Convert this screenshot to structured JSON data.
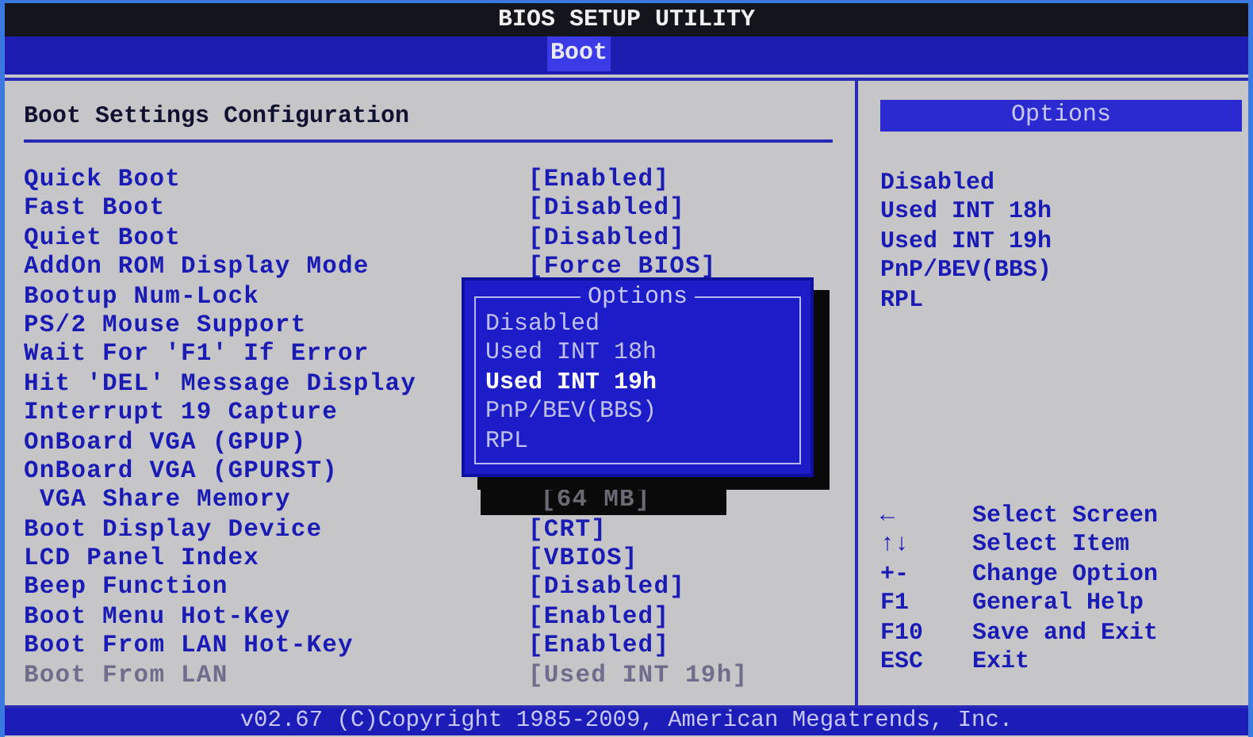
{
  "window": {
    "title": "BIOS SETUP UTILITY"
  },
  "tabs": [
    {
      "label": "Boot",
      "selected": true
    }
  ],
  "settings": {
    "heading": "Boot Settings Configuration",
    "rows": [
      {
        "label": "Quick Boot",
        "value": "[Enabled]",
        "disabled": false
      },
      {
        "label": "Fast Boot",
        "value": "[Disabled]",
        "disabled": false
      },
      {
        "label": "Quiet Boot",
        "value": "[Disabled]",
        "disabled": false
      },
      {
        "label": "AddOn ROM Display Mode",
        "value": "[Force BIOS]",
        "disabled": false
      },
      {
        "label": "Bootup Num-Lock",
        "disabled": false
      },
      {
        "label": "PS/2 Mouse Support",
        "disabled": false
      },
      {
        "label": "Wait For 'F1' If Error",
        "disabled": false
      },
      {
        "label": "Hit 'DEL' Message Display",
        "disabled": false
      },
      {
        "label": "Interrupt 19 Capture",
        "disabled": false
      },
      {
        "label": "OnBoard VGA (GPUP)",
        "disabled": false
      },
      {
        "label": "OnBoard VGA (GPURST)",
        "disabled": false,
        "children": [
          {
            "label": "VGA Share Memory",
            "value": "[64 MB]",
            "disabled": false,
            "shadowed": true
          }
        ]
      },
      {
        "label": "Boot Display Device",
        "value": "[CRT]",
        "disabled": false
      },
      {
        "label": "LCD Panel Index",
        "value": "[VBIOS]",
        "disabled": false
      },
      {
        "label": "Beep Function",
        "value": "[Disabled]",
        "disabled": false
      },
      {
        "label": "Boot Menu Hot-Key",
        "value": "[Enabled]",
        "disabled": false
      },
      {
        "label": "Boot From LAN Hot-Key",
        "value": "[Enabled]",
        "disabled": false
      },
      {
        "label": "Boot From LAN",
        "value": "[Used INT 19h]",
        "disabled": true
      }
    ]
  },
  "popup": {
    "title": "Options",
    "items": [
      {
        "label": "Disabled",
        "selected": false
      },
      {
        "label": "Used INT 18h",
        "selected": false
      },
      {
        "label": "Used INT 19h",
        "selected": true
      },
      {
        "label": "PnP/BEV(BBS)",
        "selected": false
      },
      {
        "label": "RPL",
        "selected": false
      }
    ]
  },
  "options_panel": {
    "title": "Options",
    "items": [
      "Disabled",
      "Used INT 18h",
      "Used INT 19h",
      "PnP/BEV(BBS)",
      "RPL"
    ]
  },
  "help": [
    {
      "key": "←",
      "action": "Select Screen"
    },
    {
      "key": "↑↓",
      "action": "Select Item"
    },
    {
      "key": "+-",
      "action": "Change Option"
    },
    {
      "key": "F1",
      "action": "General Help"
    },
    {
      "key": "F10",
      "action": "Save and Exit"
    },
    {
      "key": "ESC",
      "action": "Exit"
    }
  ],
  "footer": "v02.67 (C)Copyright 1985-2009, American Megatrends, Inc."
}
